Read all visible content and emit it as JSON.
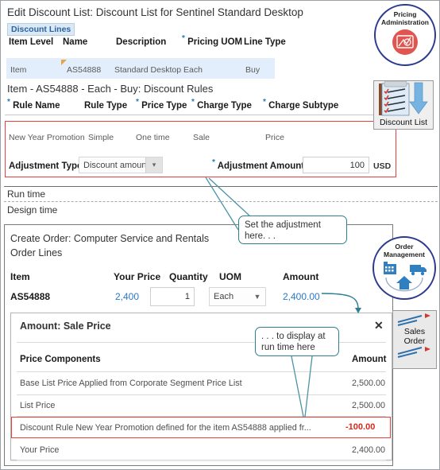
{
  "discount_list_panel": {
    "title": "Edit Discount List: Discount List for Sentinel Standard Desktop",
    "tab_label": "Discount Lines",
    "lines_columns": [
      "Item Level",
      "Name",
      "Description",
      "Pricing UOM",
      "Line Type"
    ],
    "lines_required_flags": [
      false,
      false,
      false,
      true,
      false
    ],
    "lines_row": [
      "Item",
      "AS54888",
      "Standard Desktop",
      "Each",
      "Buy"
    ],
    "rules_title": "Item - AS54888 - Each - Buy: Discount Rules",
    "rules_columns": [
      "Rule Name",
      "Rule Type",
      "Price Type",
      "Charge Type",
      "Charge Subtype"
    ],
    "rules_required_flags": [
      true,
      false,
      true,
      true,
      true
    ],
    "rules_row": [
      "New Year Promotion",
      "Simple",
      "One time",
      "Sale",
      "Price"
    ],
    "adjustment": {
      "type_label": "Adjustment Type",
      "type_value": "Discount amount",
      "amount_label": "Adjustment Amount",
      "amount_required": true,
      "amount_value": "100",
      "currency": "USD"
    },
    "highlight_color": "#e8403a"
  },
  "divider": {
    "run_time_label": "Run time",
    "design_time_label": "Design time"
  },
  "order_panel": {
    "title": "Create Order: Computer Service and Rentals",
    "subtitle": "Order Lines",
    "columns": [
      "Item",
      "Your Price",
      "Quantity",
      "UOM",
      "Amount"
    ],
    "row": {
      "item": "AS54888",
      "your_price": "2,400",
      "quantity": "1",
      "uom": "Each",
      "amount": "2,400.00"
    }
  },
  "dialog": {
    "title": "Amount: Sale Price",
    "close_label": "✕",
    "columns": [
      "Price Components",
      "Amount"
    ],
    "rows": [
      {
        "component": "Base List Price Applied from Corporate Segment Price List",
        "amount": "2,500.00",
        "highlight": false
      },
      {
        "component": "List Price",
        "amount": "2,500.00",
        "highlight": false
      },
      {
        "component": "Discount Rule New Year Promotion defined for the item AS54888 applied fr...",
        "amount": "-100.00",
        "highlight": true
      },
      {
        "component": "Your Price",
        "amount": "2,400.00",
        "highlight": false
      }
    ],
    "negative_color": "#d8281c"
  },
  "callouts": [
    {
      "id": "set-adjustment",
      "text_line1": "Set the adjustment",
      "text_line2": "here. . ."
    },
    {
      "id": "display-runtime",
      "text_line1": ". . . to display at",
      "text_line2": "run time here"
    }
  ],
  "badges": {
    "pricing_administration": {
      "line1": "Pricing",
      "line2": "Administration",
      "icon": "pricing-admin-icon"
    },
    "discount_list": {
      "label": "Discount List",
      "icon": "discount-list-icon"
    },
    "order_management": {
      "line1": "Order",
      "line2": "Management",
      "icon": "order-management-icon"
    },
    "sales_order": {
      "label_line1": "Sales",
      "label_line2": "Order",
      "icon": "sales-order-icon"
    }
  }
}
